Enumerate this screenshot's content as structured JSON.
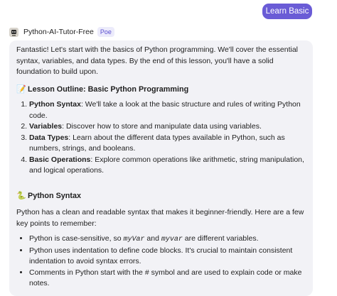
{
  "header": {
    "learn_basic_label": "Learn Basic"
  },
  "bot": {
    "name": "Python-AI-Tutor-Free",
    "badge": "Poe",
    "avatar_icon": "robot-avatar-icon"
  },
  "message": {
    "intro": "Fantastic! Let's start with the basics of Python programming. We'll cover the essential syntax, variables, and data types. By the end of this lesson, you'll have a solid foundation to build upon.",
    "outline_heading": "Lesson Outline: Basic Python Programming",
    "outline_icon": "memo-icon",
    "outline": [
      {
        "title": "Python Syntax",
        "text": ": We'll take a look at the basic structure and rules of writing Python code."
      },
      {
        "title": "Variables",
        "text": ": Discover how to store and manipulate data using variables."
      },
      {
        "title": "Data Types",
        "text": ": Learn about the different data types available in Python, such as numbers, strings, and booleans."
      },
      {
        "title": "Basic Operations",
        "text": ": Explore common operations like arithmetic, string manipulation, and logical operations."
      }
    ],
    "syntax_heading": "Python Syntax",
    "syntax_icon": "snake-icon",
    "syntax_intro": "Python has a clean and readable syntax that makes it beginner-friendly. Here are a few key points to remember:",
    "syntax_points": {
      "case_prefix": "Python is case-sensitive, so ",
      "case_code1": "myVar",
      "case_mid": " and ",
      "case_code2": "myvar",
      "case_suffix": " are different variables.",
      "indentation": "Python uses indentation to define code blocks. It's crucial to maintain consistent indentation to avoid syntax errors.",
      "comments": "Comments in Python start with the # symbol and are used to explain code or make notes."
    }
  },
  "colors": {
    "accent": "#6a5cd6",
    "bubble": "#f2f2f6"
  }
}
